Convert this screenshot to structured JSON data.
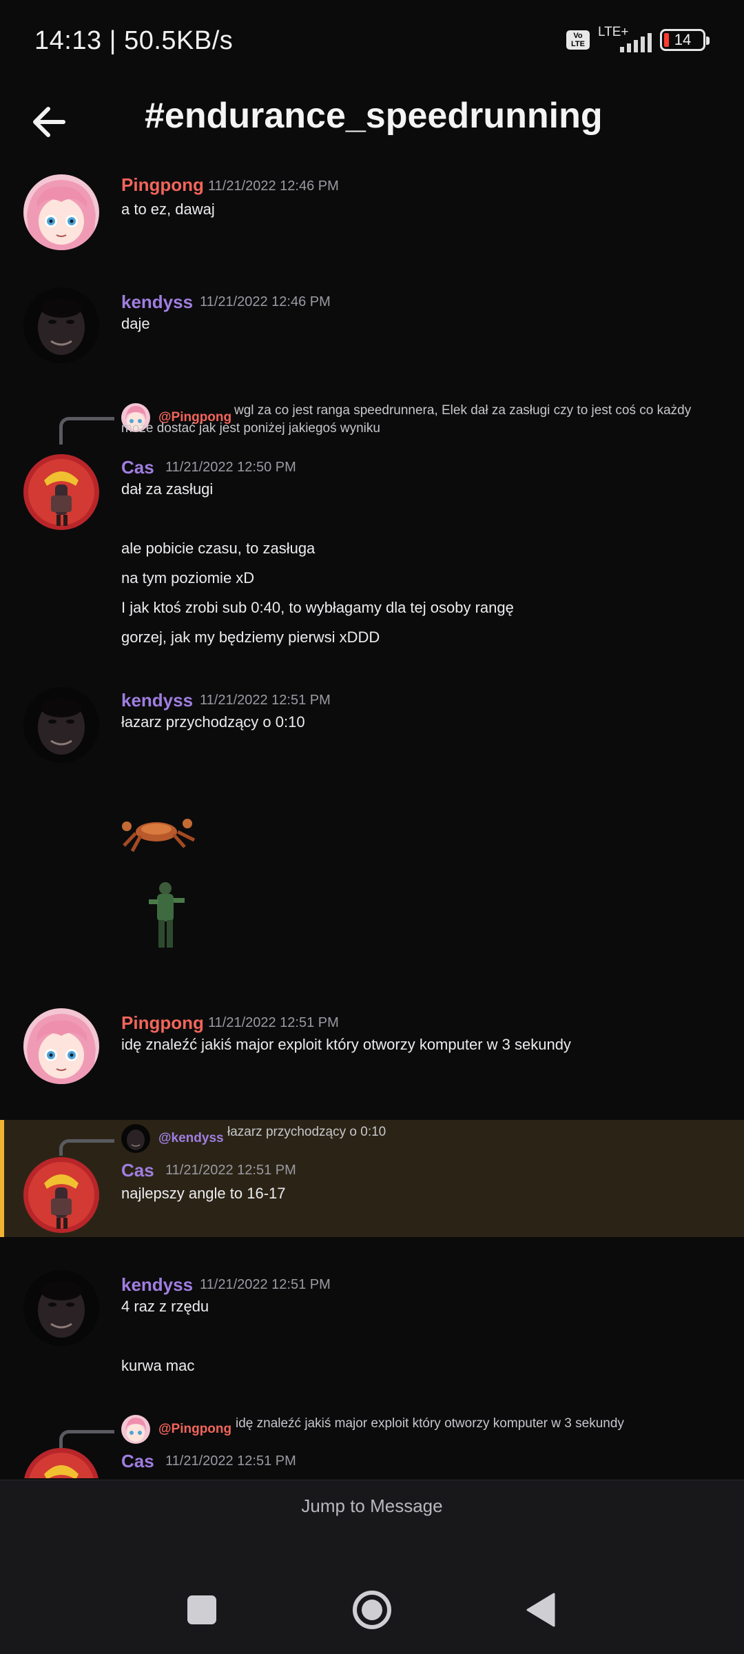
{
  "status_bar": {
    "time_speed": "14:13 | 50.5KB/s",
    "volte": "Vo LTE",
    "network": "LTE+",
    "battery": "14",
    "battery_color": "#ff3b30"
  },
  "header": {
    "channel": "#endurance_speedrunning",
    "back_icon": "arrow-left-icon"
  },
  "messages": [
    {
      "author": "Pingpong",
      "timestamp": "11/21/2022 12:46 PM",
      "lines": [
        "a to ez, dawaj"
      ]
    },
    {
      "author": "kendyss",
      "timestamp": "11/21/2022 12:46 PM",
      "lines": [
        "daje"
      ]
    },
    {
      "reply_to": "@Pingpong",
      "reply_text": "wgl za co jest ranga speedrunnera, Elek dał za zasługi czy to jest coś co każdy może dostać jak jest poniżej jakiegoś wyniku",
      "author": "Cas",
      "timestamp": "11/21/2022 12:50 PM",
      "lines": [
        "dał za zasługi",
        "ale pobicie czasu, to zasługa",
        "na tym poziomie xD",
        "I jak ktoś zrobi sub 0:40, to wybłagamy dla tej osoby rangę",
        "gorzej, jak my będziemy pierwsi xDDD"
      ]
    },
    {
      "author": "kendyss",
      "timestamp": "11/21/2022 12:51 PM",
      "lines": [
        "łazarz przychodzący o 0:10"
      ],
      "attachments": [
        "crab-sprite-icon",
        "soldier-sprite-icon"
      ]
    },
    {
      "author": "Pingpong",
      "timestamp": "11/21/2022 12:51 PM",
      "lines": [
        "idę znaleźć jakiś major exploit który otworzy komputer w 3 sekundy"
      ]
    },
    {
      "reply_to": "@kendyss",
      "reply_text": "łazarz przychodzący o 0:10",
      "author": "Cas",
      "timestamp": "11/21/2022 12:51 PM",
      "lines": [
        "najlepszy angle to 16-17"
      ],
      "highlighted": true,
      "highlight_color": "#f0b232"
    },
    {
      "author": "kendyss",
      "timestamp": "11/21/2022 12:51 PM",
      "lines": [
        "4 raz z rzędu",
        "kurwa mac"
      ]
    },
    {
      "reply_to": "@Pingpong",
      "reply_text": "idę znaleźć jakiś major exploit który otworzy komputer w 3 sekundy",
      "author": "Cas",
      "timestamp": "11/21/2022 12:51 PM",
      "lines": []
    }
  ],
  "colors": {
    "pingpong_name": "#f2655a",
    "kendyss_name": "#a07ee0",
    "cas_name": "#a07ee0"
  },
  "jump_to_message": "Jump to Message",
  "navbar": {
    "recents": "square-icon",
    "home": "circle-icon",
    "back": "triangle-back-icon"
  }
}
